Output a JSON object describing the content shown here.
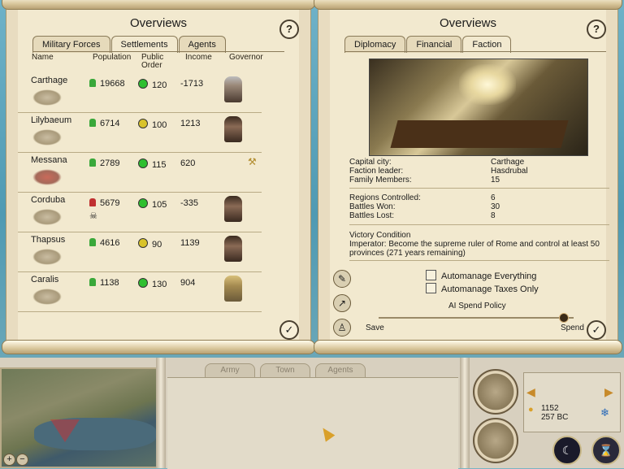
{
  "left": {
    "title": "Overviews",
    "tabs": [
      "Military Forces",
      "Settlements",
      "Agents"
    ],
    "headers": {
      "name": "Name",
      "population": "Population",
      "public_order": "Public Order",
      "income": "Income",
      "governor": "Governor"
    },
    "rows": [
      {
        "name": "Carthage",
        "population": "19668",
        "order": "120",
        "income": "-1713"
      },
      {
        "name": "Lilybaeum",
        "population": "6714",
        "order": "100",
        "income": "1213"
      },
      {
        "name": "Messana",
        "population": "2789",
        "order": "115",
        "income": "620"
      },
      {
        "name": "Corduba",
        "population": "5679",
        "order": "105",
        "income": "-335"
      },
      {
        "name": "Thapsus",
        "population": "4616",
        "order": "90",
        "income": "1139"
      },
      {
        "name": "Caralis",
        "population": "1138",
        "order": "130",
        "income": "904"
      }
    ]
  },
  "right": {
    "title": "Overviews",
    "tabs": [
      "Diplomacy",
      "Financial",
      "Faction"
    ],
    "capital_label": "Capital city:",
    "capital_value": "Carthage",
    "leader_label": "Faction leader:",
    "leader_value": "Hasdrubal",
    "members_label": "Family Members:",
    "members_value": "15",
    "regions_label": "Regions Controlled:",
    "regions_value": "6",
    "won_label": "Battles Won:",
    "won_value": "30",
    "lost_label": "Battles Lost:",
    "lost_value": "8",
    "victory_title": "Victory Condition",
    "victory_text": "Imperator: Become the supreme ruler of Rome and control at least 50 provinces (271 years remaining)",
    "auto_everything": "Automanage Everything",
    "auto_taxes": "Automanage Taxes Only",
    "spend_policy": "AI Spend Policy",
    "save": "Save",
    "spend": "Spend"
  },
  "bottom": {
    "tabs": [
      "Army",
      "Town",
      "Agents"
    ],
    "money": "1152",
    "year": "257 BC"
  },
  "help": "?",
  "confirm": "✓"
}
